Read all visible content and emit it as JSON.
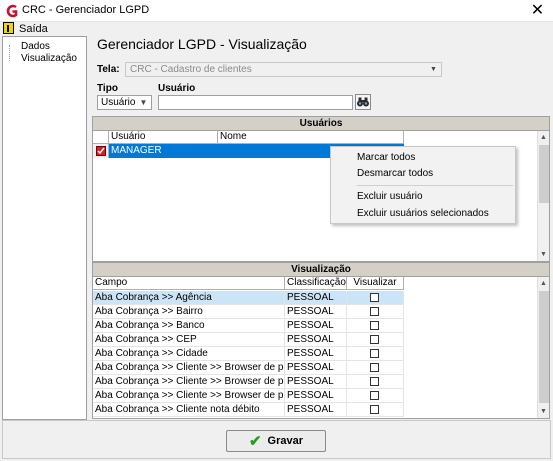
{
  "window": {
    "title": "CRC - Gerenciador LGPD",
    "close_glyph": "✕"
  },
  "menu": {
    "items": [
      {
        "label": "Saída",
        "icon": "exit-door-icon"
      }
    ]
  },
  "nav": {
    "items": [
      {
        "label": "Dados"
      },
      {
        "label": "Visualização"
      }
    ]
  },
  "page": {
    "title": "Gerenciador LGPD - Visualização"
  },
  "filters": {
    "tela_label": "Tela:",
    "tela_value": "CRC - Cadastro de clientes",
    "tipo_label": "Tipo",
    "tipo_value": "Usuário",
    "usuario_label": "Usuário",
    "usuario_value": ""
  },
  "users_panel": {
    "title": "Usuários",
    "columns": [
      "Usuário",
      "Nome"
    ],
    "rows": [
      {
        "checked": true,
        "usuario": "MANAGER",
        "nome": ""
      }
    ]
  },
  "context_menu": {
    "items": [
      "Marcar todos",
      "Desmarcar todos",
      "Excluir usuário",
      "Excluir usuários selecionados"
    ]
  },
  "vis_panel": {
    "title": "Visualização",
    "columns": [
      "Campo",
      "Classificação",
      "Visualizar"
    ],
    "rows": [
      {
        "campo": "Aba Cobrança >> Agência",
        "classificacao": "PESSOAL",
        "visualizar": false
      },
      {
        "campo": "Aba Cobrança >> Bairro",
        "classificacao": "PESSOAL",
        "visualizar": false
      },
      {
        "campo": "Aba Cobrança >> Banco",
        "classificacao": "PESSOAL",
        "visualizar": false
      },
      {
        "campo": "Aba Cobrança >> CEP",
        "classificacao": "PESSOAL",
        "visualizar": false
      },
      {
        "campo": "Aba Cobrança >> Cidade",
        "classificacao": "PESSOAL",
        "visualizar": false
      },
      {
        "campo": "Aba Cobrança >> Cliente >> Browser de pesquisa ...",
        "classificacao": "PESSOAL",
        "visualizar": false
      },
      {
        "campo": "Aba Cobrança >> Cliente >> Browser de pesquisa ...",
        "classificacao": "PESSOAL",
        "visualizar": false
      },
      {
        "campo": "Aba Cobrança >> Cliente >> Browser de pesquisa ...",
        "classificacao": "PESSOAL",
        "visualizar": false
      },
      {
        "campo": "Aba Cobrança >> Cliente nota débito",
        "classificacao": "PESSOAL",
        "visualizar": false
      }
    ]
  },
  "footer": {
    "save_label": "Gravar",
    "save_icon": "checkmark-icon"
  },
  "colors": {
    "selection": "#0078d7",
    "first_row_highlight": "#cce4f7",
    "checkbox_red": "#d42020",
    "brand_red": "#c8102e"
  }
}
